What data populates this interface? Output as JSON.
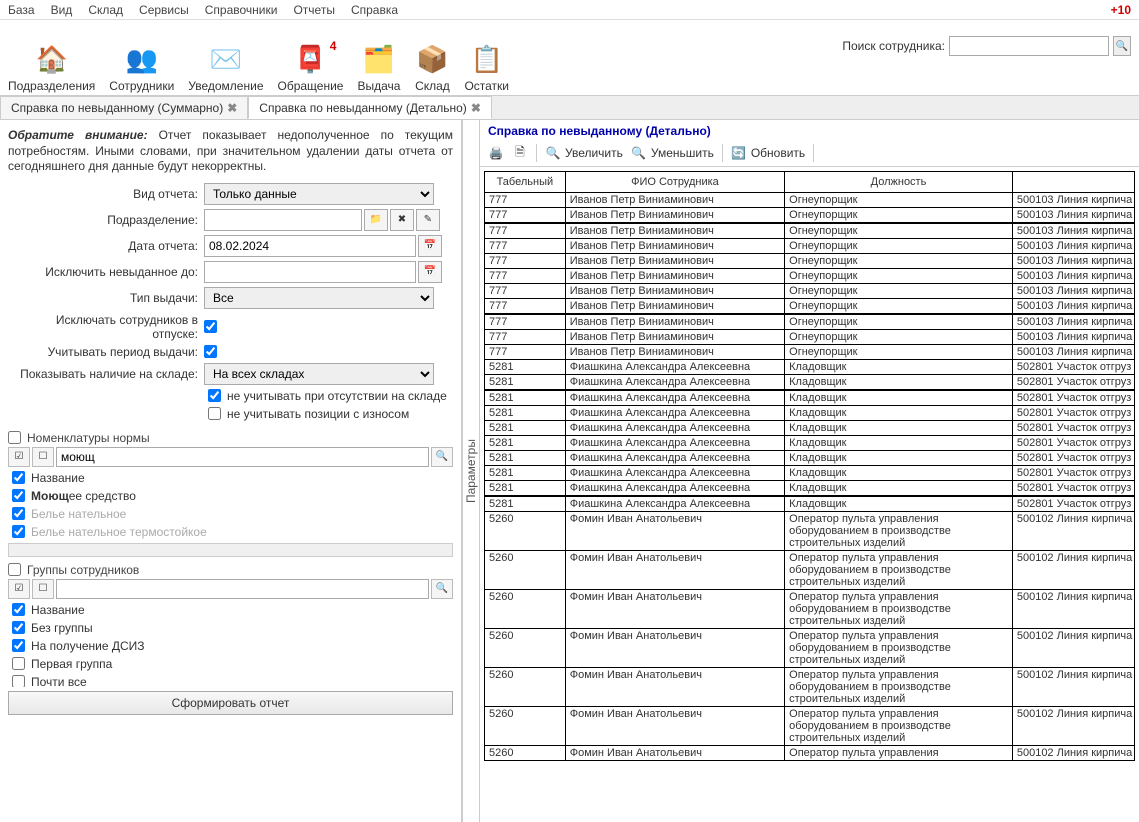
{
  "menu": [
    "База",
    "Вид",
    "Склад",
    "Сервисы",
    "Справочники",
    "Отчеты",
    "Справка"
  ],
  "badge": "+10",
  "toolbar": [
    {
      "label": "Подразделения",
      "icon": "🏠"
    },
    {
      "label": "Сотрудники",
      "icon": "👥"
    },
    {
      "label": "Уведомление",
      "icon": "✉️"
    },
    {
      "label": "Обращение",
      "icon": "📮",
      "num": "4"
    },
    {
      "label": "Выдача",
      "icon": "🗂️"
    },
    {
      "label": "Склад",
      "icon": "📦"
    },
    {
      "label": "Остатки",
      "icon": "📋"
    }
  ],
  "search": {
    "label": "Поиск сотрудника:",
    "placeholder": ""
  },
  "tabs": [
    {
      "label": "Справка по невыданному (Суммарно)",
      "active": false
    },
    {
      "label": "Справка по невыданному (Детально)",
      "active": true
    }
  ],
  "info": {
    "lead": "Обратите внимание:",
    "text": " Отчет показывает недополученное по текущим потребностям. Иными словами, при значительном удалении даты отчета от сегодняшнего дня данные будут некорректны."
  },
  "form": {
    "report_type_label": "Вид отчета:",
    "report_type": "Только данные",
    "dept_label": "Подразделение:",
    "dept": "",
    "date_label": "Дата отчета:",
    "date": "08.02.2024",
    "exclude_label": "Исключить невыданное до:",
    "exclude": "",
    "issue_type_label": "Тип выдачи:",
    "issue_type": "Все",
    "vacation_label": "Исключать сотрудников в отпуске:",
    "period_label": "Учитывать период выдачи:",
    "stock_label": "Показывать наличие на складе:",
    "stock": "На всех складах",
    "opt1": "не учитывать при отсутствии на складе",
    "opt2": "не учитывать позиции с износом"
  },
  "nomen": {
    "title": "Номенклатуры нормы",
    "search": "моющ",
    "items": [
      {
        "label": "Название",
        "checked": true,
        "head": true
      },
      {
        "label_pre": "Моющ",
        "label_suf": "ее средство",
        "checked": true,
        "highlight": true
      },
      {
        "label": "Белье нательное",
        "checked": true,
        "dim": true
      },
      {
        "label": "Белье нательное  термостойкое",
        "checked": true,
        "dim": true
      }
    ]
  },
  "groups": {
    "title": "Группы сотрудников",
    "search": "",
    "items": [
      {
        "label": "Название",
        "checked": true,
        "head": true
      },
      {
        "label": "Без группы",
        "checked": true
      },
      {
        "label": "На получение ДСИЗ",
        "checked": true
      },
      {
        "label": "Первая группа",
        "checked": false
      },
      {
        "label": "Почти все",
        "checked": false
      }
    ]
  },
  "gen_btn": "Сформировать отчет",
  "vert": "Параметры",
  "right": {
    "title": "Справка по невыданному (Детально)",
    "tools": {
      "zoom_in": "Увеличить",
      "zoom_out": "Уменьшить",
      "refresh": "Обновить"
    }
  },
  "columns": [
    "Табельный",
    "ФИО Сотрудника",
    "Должность",
    ""
  ],
  "rows": [
    {
      "g": 0,
      "tab": "777",
      "fio": "Иванов Петр Виниаминович",
      "dol": "Огнеупорщик",
      "dep": "500103 Линия кирпича"
    },
    {
      "g": 0,
      "tab": "777",
      "fio": "Иванов Петр Виниаминович",
      "dol": "Огнеупорщик",
      "dep": "500103 Линия кирпича"
    },
    {
      "g": 1,
      "tab": "777",
      "fio": "Иванов Петр Виниаминович",
      "dol": "Огнеупорщик",
      "dep": "500103 Линия кирпича"
    },
    {
      "g": 1,
      "tab": "777",
      "fio": "Иванов Петр Виниаминович",
      "dol": "Огнеупорщик",
      "dep": "500103 Линия кирпича"
    },
    {
      "g": 1,
      "tab": "777",
      "fio": "Иванов Петр Виниаминович",
      "dol": "Огнеупорщик",
      "dep": "500103 Линия кирпича"
    },
    {
      "g": 1,
      "tab": "777",
      "fio": "Иванов Петр Виниаминович",
      "dol": "Огнеупорщик",
      "dep": "500103 Линия кирпича"
    },
    {
      "g": 1,
      "tab": "777",
      "fio": "Иванов Петр Виниаминович",
      "dol": "Огнеупорщик",
      "dep": "500103 Линия кирпича"
    },
    {
      "g": 1,
      "tab": "777",
      "fio": "Иванов Петр Виниаминович",
      "dol": "Огнеупорщик",
      "dep": "500103 Линия кирпича"
    },
    {
      "g": 2,
      "tab": "777",
      "fio": "Иванов Петр Виниаминович",
      "dol": "Огнеупорщик",
      "dep": "500103 Линия кирпича"
    },
    {
      "g": 2,
      "tab": "777",
      "fio": "Иванов Петр Виниаминович",
      "dol": "Огнеупорщик",
      "dep": "500103 Линия кирпича"
    },
    {
      "g": 2,
      "tab": "777",
      "fio": "Иванов Петр Виниаминович",
      "dol": "Огнеупорщик",
      "dep": "500103 Линия кирпича"
    },
    {
      "g": 2,
      "tab": "5281",
      "fio": "Фиашкина Александра Алексеевна",
      "dol": "Кладовщик",
      "dep": "502801 Участок отгруз"
    },
    {
      "g": 2,
      "tab": "5281",
      "fio": "Фиашкина Александра Алексеевна",
      "dol": "Кладовщик",
      "dep": "502801 Участок отгруз"
    },
    {
      "g": 3,
      "tab": "5281",
      "fio": "Фиашкина Александра Алексеевна",
      "dol": "Кладовщик",
      "dep": "502801 Участок отгруз"
    },
    {
      "g": 3,
      "tab": "5281",
      "fio": "Фиашкина Александра Алексеевна",
      "dol": "Кладовщик",
      "dep": "502801 Участок отгруз"
    },
    {
      "g": 3,
      "tab": "5281",
      "fio": "Фиашкина Александра Алексеевна",
      "dol": "Кладовщик",
      "dep": "502801 Участок отгруз"
    },
    {
      "g": 3,
      "tab": "5281",
      "fio": "Фиашкина Александра Алексеевна",
      "dol": "Кладовщик",
      "dep": "502801 Участок отгруз"
    },
    {
      "g": 3,
      "tab": "5281",
      "fio": "Фиашкина Александра Алексеевна",
      "dol": "Кладовщик",
      "dep": "502801 Участок отгруз"
    },
    {
      "g": 3,
      "tab": "5281",
      "fio": "Фиашкина Александра Алексеевна",
      "dol": "Кладовщик",
      "dep": "502801 Участок отгруз"
    },
    {
      "g": 3,
      "tab": "5281",
      "fio": "Фиашкина Александра Алексеевна",
      "dol": "Кладовщик",
      "dep": "502801 Участок отгруз"
    },
    {
      "g": 4,
      "tab": "5281",
      "fio": "Фиашкина Александра Алексеевна",
      "dol": "Кладовщик",
      "dep": "502801 Участок отгруз"
    },
    {
      "g": 4,
      "tab": "5260",
      "fio": "Фомин Иван Анатольевич",
      "dol": "Оператор пульта управления оборудованием в производстве строительных изделий",
      "dep": "500102 Линия кирпича"
    },
    {
      "g": 4,
      "tab": "5260",
      "fio": "Фомин Иван Анатольевич",
      "dol": "Оператор пульта управления оборудованием в производстве строительных изделий",
      "dep": "500102 Линия кирпича"
    },
    {
      "g": 4,
      "tab": "5260",
      "fio": "Фомин Иван Анатольевич",
      "dol": "Оператор пульта управления оборудованием в производстве строительных изделий",
      "dep": "500102 Линия кирпича"
    },
    {
      "g": 4,
      "tab": "5260",
      "fio": "Фомин Иван Анатольевич",
      "dol": "Оператор пульта управления оборудованием в производстве строительных изделий",
      "dep": "500102 Линия кирпича"
    },
    {
      "g": 4,
      "tab": "5260",
      "fio": "Фомин Иван Анатольевич",
      "dol": "Оператор пульта управления оборудованием в производстве строительных изделий",
      "dep": "500102 Линия кирпича"
    },
    {
      "g": 4,
      "tab": "5260",
      "fio": "Фомин Иван Анатольевич",
      "dol": "Оператор пульта управления оборудованием в производстве строительных изделий",
      "dep": "500102 Линия кирпича"
    },
    {
      "g": 4,
      "tab": "5260",
      "fio": "Фомин Иван Анатольевич",
      "dol": "Оператор пульта управления",
      "dep": "500102 Линия кирпича"
    }
  ]
}
